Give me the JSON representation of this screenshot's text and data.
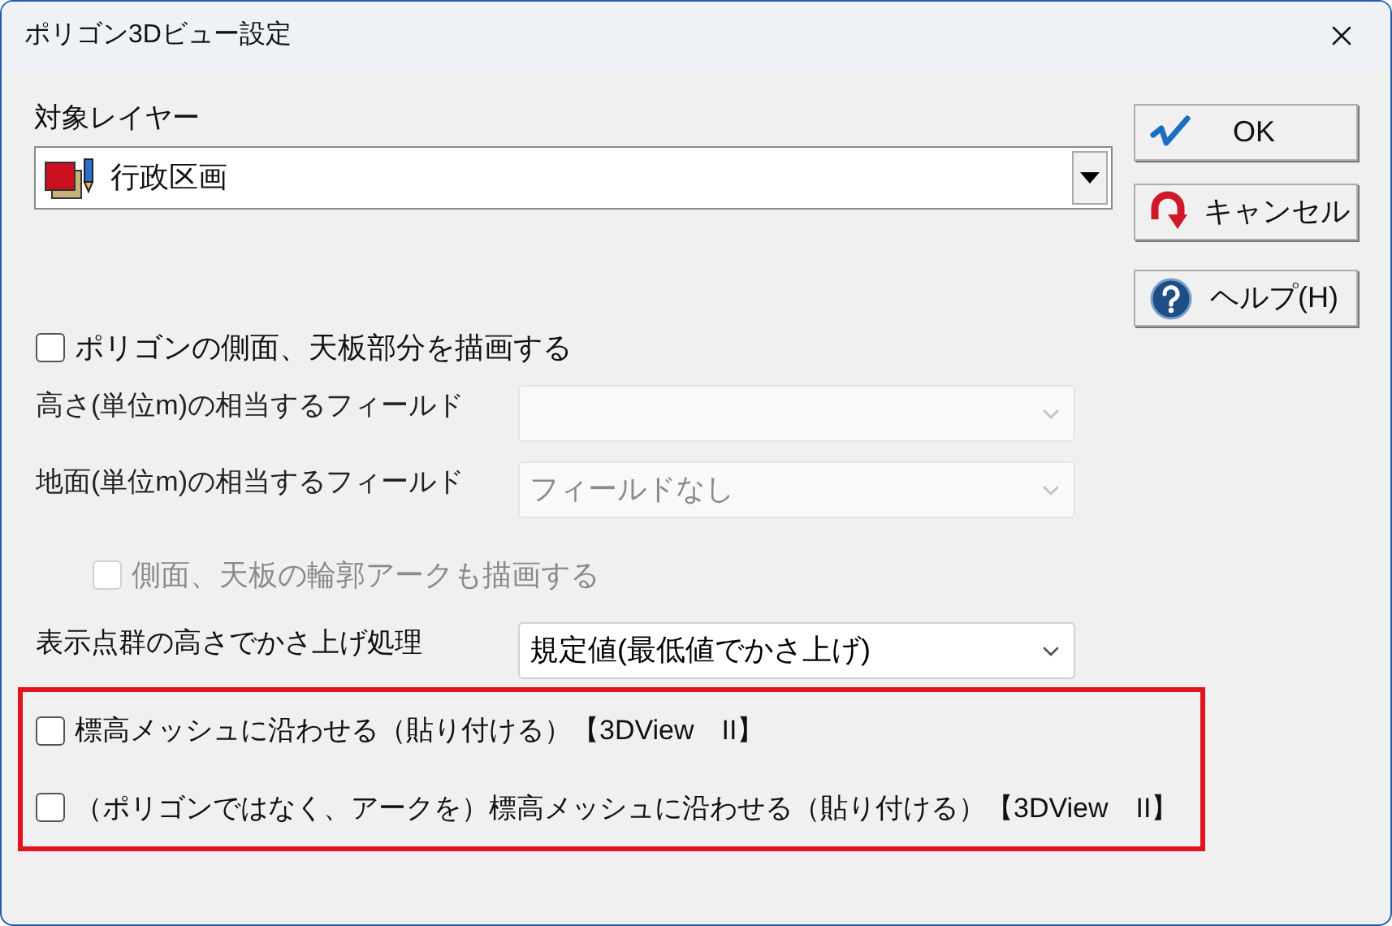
{
  "window": {
    "title": "ポリゴン3Dビュー設定"
  },
  "target_layer": {
    "label": "対象レイヤー",
    "value": "行政区画"
  },
  "buttons": [
    {
      "label": "OK",
      "kind": "ok"
    },
    {
      "label": "キャンセル",
      "kind": "cancel"
    },
    {
      "label": "ヘルプ(H)",
      "kind": "help"
    }
  ],
  "draw_sides": {
    "label": "ポリゴンの側面、天板部分を描画する",
    "checked": false
  },
  "fields": [
    {
      "label": "高さ(単位m)の相当するフィールド",
      "disabled": true
    },
    {
      "label": "地面(単位m)の相当するフィールド",
      "value": "フィールドなし",
      "disabled": true
    }
  ],
  "outline": {
    "label": "側面、天板の輪郭アークも描画する",
    "checked": false,
    "disabled": true
  },
  "raise": {
    "label": "表示点群の高さでかさ上げ処理",
    "value": "規定値(最低値でかさ上げ)",
    "disabled": false
  },
  "mesh_options": [
    {
      "label": "標高メッシュに沿わせる（貼り付ける）【3DView　II】",
      "checked": false
    },
    {
      "label": "（ポリゴンではなく、アークを）標高メッシュに沿わせる（貼り付ける）【3DView　II】",
      "checked": false
    }
  ]
}
